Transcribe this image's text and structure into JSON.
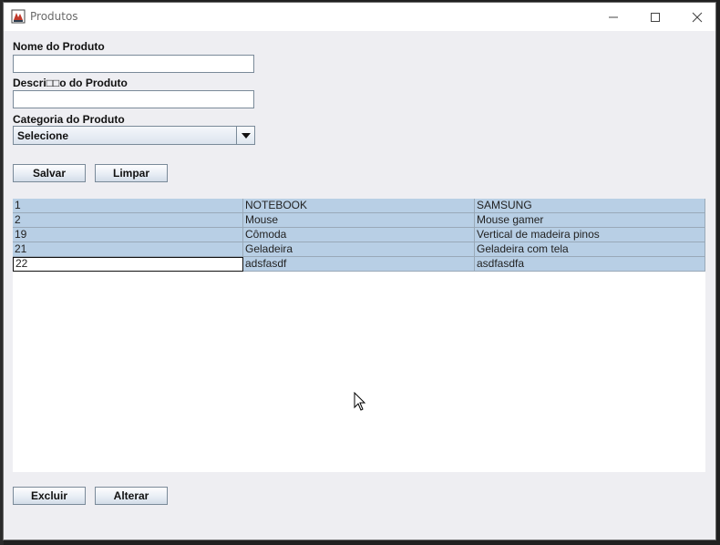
{
  "window": {
    "title": "Produtos"
  },
  "form": {
    "name_label": "Nome do Produto",
    "name_value": "",
    "description_label": "Descri□□o do Produto",
    "description_value": "",
    "category_label": "Categoria do Produto",
    "category_selected": "Selecione"
  },
  "buttons": {
    "save": "Salvar",
    "clear": "Limpar",
    "delete": "Excluir",
    "edit": "Alterar"
  },
  "table": {
    "rows": [
      [
        "1",
        "NOTEBOOK",
        "SAMSUNG"
      ],
      [
        "2",
        "Mouse",
        "Mouse gamer"
      ],
      [
        "19",
        "Cômoda",
        "Vertical de madeira pinos"
      ],
      [
        "21",
        "Geladeira",
        "Geladeira com tela"
      ],
      [
        "22",
        "adsfasdf",
        "asdfasdfa"
      ]
    ]
  },
  "icons": {
    "app": "java-app-icon",
    "minimize": "minimize-icon",
    "maximize": "maximize-icon",
    "close": "close-icon",
    "dropdown": "chevron-down-icon",
    "cursor": "mouse-pointer-icon"
  },
  "colors": {
    "selection_row": "#b8cfe5",
    "window_bg": "#eeeef2"
  }
}
